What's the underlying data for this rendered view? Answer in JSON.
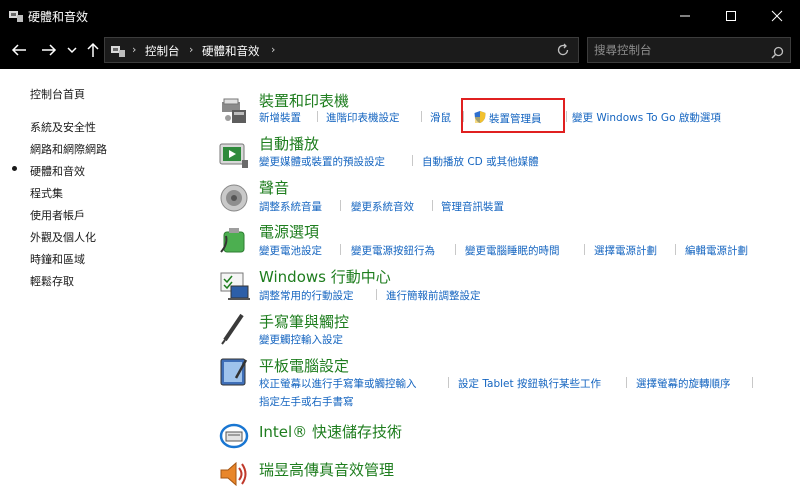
{
  "window": {
    "title": "硬體和音效",
    "colors": {
      "titlebar_bg": "#000000",
      "category_title": "#1e7d1e",
      "link": "#1565c0",
      "highlight_box": "#e02020"
    }
  },
  "address": {
    "breadcrumbs": [
      "控制台",
      "硬體和音效"
    ],
    "search_placeholder": "搜尋控制台"
  },
  "sidebar": {
    "items": [
      {
        "label": "控制台首頁"
      },
      {
        "label": "系統及安全性"
      },
      {
        "label": "網路和網際網路"
      },
      {
        "label": "硬體和音效",
        "selected": true
      },
      {
        "label": "程式集"
      },
      {
        "label": "使用者帳戶"
      },
      {
        "label": "外觀及個人化"
      },
      {
        "label": "時鐘和區域"
      },
      {
        "label": "輕鬆存取"
      }
    ]
  },
  "categories": [
    {
      "title": "裝置和印表機",
      "links": [
        "新增裝置",
        "進階印表機設定",
        "滑鼠",
        "裝置管理員",
        "變更 Windows To Go 啟動選項"
      ]
    },
    {
      "title": "自動播放",
      "links": [
        "變更媒體或裝置的預設設定",
        "自動播放 CD 或其他媒體"
      ]
    },
    {
      "title": "聲音",
      "links": [
        "調整系統音量",
        "變更系統音效",
        "管理音訊裝置"
      ]
    },
    {
      "title": "電源選項",
      "links": [
        "變更電池設定",
        "變更電源按鈕行為",
        "變更電腦睡眠的時間",
        "選擇電源計劃",
        "編輯電源計劃"
      ]
    },
    {
      "title": "Windows 行動中心",
      "links": [
        "調整常用的行動設定",
        "進行簡報前調整設定"
      ]
    },
    {
      "title": "手寫筆與觸控",
      "links": [
        "變更觸控輸入設定"
      ]
    },
    {
      "title": "平板電腦設定",
      "links": [
        "校正螢幕以進行手寫筆或觸控輸入",
        "設定 Tablet 按鈕執行某些工作",
        "選擇螢幕的旋轉順序",
        "指定左手或右手書寫"
      ]
    },
    {
      "title": "Intel® 快速儲存技術",
      "links": []
    },
    {
      "title": "瑞昱高傳真音效管理",
      "links": []
    }
  ]
}
